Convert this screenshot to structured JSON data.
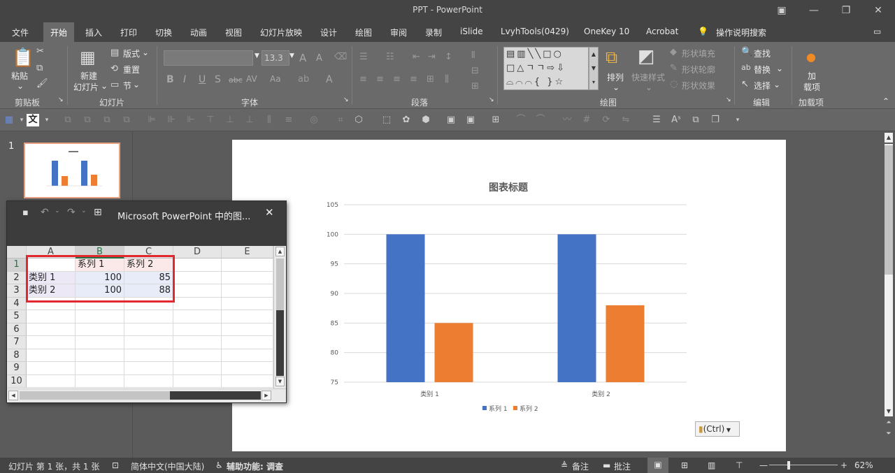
{
  "window": {
    "title": "PPT  -  PowerPoint"
  },
  "menu": {
    "items": [
      "文件",
      "开始",
      "插入",
      "打印",
      "切换",
      "动画",
      "视图",
      "幻灯片放映",
      "设计",
      "绘图",
      "审阅",
      "录制",
      "iSlide",
      "LvyhTools(0429)",
      "OneKey 10",
      "Acrobat"
    ],
    "active": "开始",
    "search_label": "操作说明搜索"
  },
  "ribbon": {
    "clipboard": {
      "paste": "粘贴",
      "group_label": "剪贴板"
    },
    "slides": {
      "new_slide_line1": "新建",
      "new_slide_line2": "幻灯片",
      "layout": "版式",
      "reset": "重置",
      "section": "节",
      "group_label": "幻灯片"
    },
    "font": {
      "font_name": "",
      "font_size": "13.3",
      "bold": "B",
      "italic": "I",
      "underline": "U",
      "shadow": "S",
      "strike": "abc",
      "spacing": "AV",
      "case": "Aa",
      "grow": "A",
      "shrink": "A",
      "color": "A",
      "group_label": "字体"
    },
    "paragraph": {
      "group_label": "段落"
    },
    "drawing": {
      "arrange": "排列",
      "quick_styles": "快速样式",
      "shape_fill": "形状填充",
      "shape_outline": "形状轮廓",
      "shape_effects": "形状效果",
      "group_label": "绘图"
    },
    "editing": {
      "find": "查找",
      "replace": "替换",
      "select": "选择",
      "group_label": "编辑"
    },
    "addins": {
      "label_line1": "加",
      "label_line2": "载项",
      "group_label": "加载项"
    }
  },
  "thumbnails": {
    "slide_number": "1"
  },
  "excel_window": {
    "title": "Microsoft PowerPoint 中的图...",
    "columns": [
      "A",
      "B",
      "C",
      "D",
      "E"
    ],
    "rows": [
      "1",
      "2",
      "3",
      "4",
      "5",
      "6",
      "7",
      "8",
      "9",
      "10"
    ],
    "cells": [
      [
        "",
        "系列 1",
        "系列 2"
      ],
      [
        "类别 1",
        "100",
        "85"
      ],
      [
        "类别 2",
        "100",
        "88"
      ]
    ]
  },
  "chart_data": {
    "type": "bar",
    "title": "图表标题",
    "categories": [
      "类别 1",
      "类别 2"
    ],
    "series": [
      {
        "name": "系列 1",
        "values": [
          100,
          100
        ],
        "color": "#4472c4"
      },
      {
        "name": "系列 2",
        "values": [
          85,
          88
        ],
        "color": "#ed7d31"
      }
    ],
    "ylim": [
      75,
      105
    ],
    "yticks": [
      75,
      80,
      85,
      90,
      95,
      100,
      105
    ],
    "grid": true,
    "legend": "bottom",
    "xlabel": "",
    "ylabel": ""
  },
  "paste_options": {
    "label": "(Ctrl)"
  },
  "statusbar": {
    "slide_info": "幻灯片 第 1 张，共 1 张",
    "language": "简体中文(中国大陆)",
    "accessibility": "辅助功能: 调查",
    "notes": "备注",
    "comments": "批注",
    "zoom": "62%"
  }
}
